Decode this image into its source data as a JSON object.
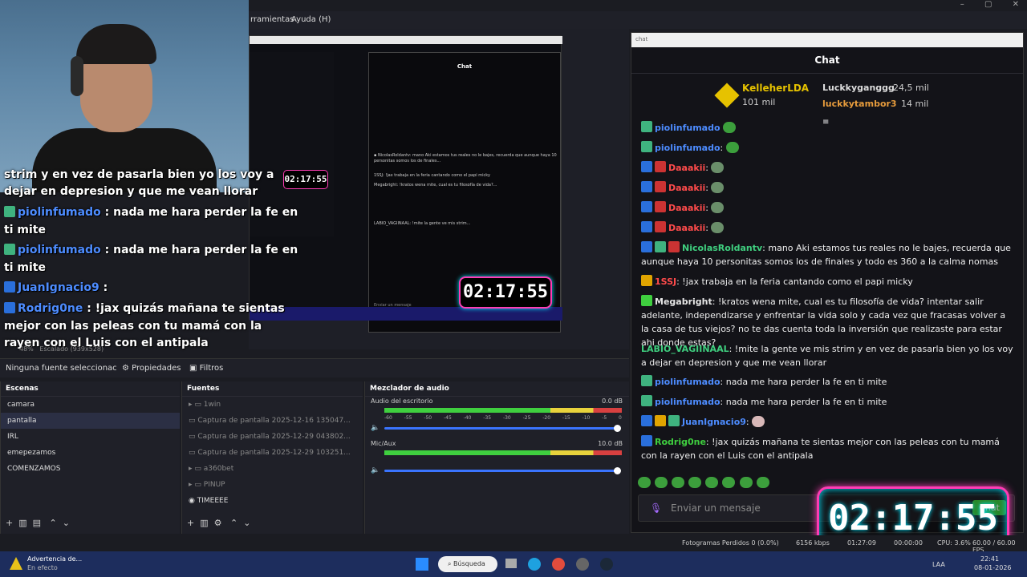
{
  "menubar": {
    "tools": "rramientas",
    "help": "Ayuda (H)"
  },
  "window_controls": {
    "min": "–",
    "max": "▢",
    "close": "✕"
  },
  "overlay": {
    "line1": "strim y en vez de pasarla bien yo los voy a",
    "line2": "dejar en depresion y que me vean llorar",
    "m2_name": "piolinfumado",
    "m2_text": ": nada me hara perder la fe en",
    "m2_cont": "ti mite",
    "m3_name": "piolinfumado",
    "m3_text": ": nada me hara perder la fe en",
    "m3_cont": "ti mite",
    "m4_name": "JuanIgnacio9",
    "m5_name": "Rodrig0ne",
    "m5_text": ": !jax quizás mañana te sientas",
    "m5_l2": "mejor con las peleas con tu mamá con la",
    "m5_l3": "rayen con el Luis con el antipala"
  },
  "preview_status": {
    "zoom": "48%",
    "scale": "Escalado (939x528)"
  },
  "nested": {
    "chat_title": "Chat",
    "send_placeholder": "Enviar un mensaje",
    "timer": "02:17:55",
    "stream_timer": "02:17:55"
  },
  "propbar": {
    "no_source": "Ninguna fuente seleccionac",
    "properties": "Propiedades",
    "filters": "Filtros"
  },
  "scenes": {
    "title": "Escenas",
    "items": [
      "camara",
      "pantalla",
      "IRL",
      "emepezamos",
      "COMENZAMOS"
    ]
  },
  "sources": {
    "title": "Fuentes",
    "items": [
      "1win",
      "Captura de pantalla 2025-12-16 135047...",
      "Captura de pantalla 2025-12-29 043802...",
      "Captura de pantalla 2025-12-29 103251...",
      "a360bet",
      "PINUP",
      "TIMEEEE"
    ]
  },
  "mixer": {
    "title": "Mezclador de audio",
    "ch1": "Audio del escritorio",
    "ch1_db": "0.0 dB",
    "ch2": "Mic/Aux",
    "ch2_db": "10.0 dB",
    "scale": [
      "-60",
      "-55",
      "-50",
      "-45",
      "-40",
      "-35",
      "-30",
      "-25",
      "-20",
      "-15",
      "-10",
      "-5",
      "0"
    ]
  },
  "chat": {
    "window_title": "chat",
    "header": "Chat",
    "leaders": {
      "first_name": "KelleherLDA",
      "first_value": "101 mil",
      "second_name": "Luckkyganggg",
      "second_value": "24,5 mil",
      "third_name": "luckkytambor3",
      "third_value": "14 mil"
    },
    "messages": [
      {
        "name": "piolinfumado",
        "text": ""
      },
      {
        "name": "Daaakii",
        "text": ""
      },
      {
        "name": "Daaakii",
        "text": ""
      },
      {
        "name": "Daaakii",
        "text": ""
      },
      {
        "name": "Daaakii",
        "text": ""
      },
      {
        "name": "NicolasRoldantv",
        "text": ": mano Aki estamos tus reales no le bajes, recuerda que aunque haya 10 personitas somos los de finales y todo es 360 a la calma nomas"
      },
      {
        "name": "1SSJ",
        "text": ": !jax trabaja en la feria cantando como el papi micky"
      },
      {
        "name": "Megabright",
        "text": ": !kratos wena mite, cual es tu filosofía de vida? intentar salir adelante, independizarse y enfrentar la vida solo y cada vez que fracasas volver a la casa de tus viejos? no te das cuenta toda la inversión que realizaste para estar ahi donde estas?"
      },
      {
        "name": "LABIO_VAGIINAAL",
        "text": ": !mite la gente ve mis strim y en vez de pasarla bien yo los voy a dejar en depresion y que me vean llorar"
      },
      {
        "name": "piolinfumado",
        "text": ": nada me hara perder la fe en ti mite"
      },
      {
        "name": "piolinfumado",
        "text": ": nada me hara perder la fe en ti mite"
      },
      {
        "name": "JuanIgnacio9",
        "text": ":"
      },
      {
        "name": "Rodrig0ne",
        "text": ": !jax quizás mañana te sientas mejor con las peleas con tu mamá con la rayen con el Luis con el antipala"
      }
    ],
    "input_placeholder": "Enviar un mensaje",
    "send": "Chat",
    "timer": "02:17:55"
  },
  "status": {
    "dropped": "Fotogramas Perdidos 0 (0.0%)",
    "kbps": "6156 kbps",
    "time": "01:27:09",
    "rec": "00:00:00",
    "cpu": "CPU: 3.6%",
    "fps": "60.00 / 60.00 FPS"
  },
  "taskbar": {
    "notif_title": "Advertencia de...",
    "notif_sub": "En efecto",
    "search": "Búsqueda",
    "lang": "LAA",
    "time": "22:41",
    "date": "08-01-2026"
  },
  "colors": {
    "accent": "#2a6fdb",
    "chat_bg": "#131318",
    "timer_border": "#ff3cb5",
    "timer_glow": "#00e5ff"
  }
}
